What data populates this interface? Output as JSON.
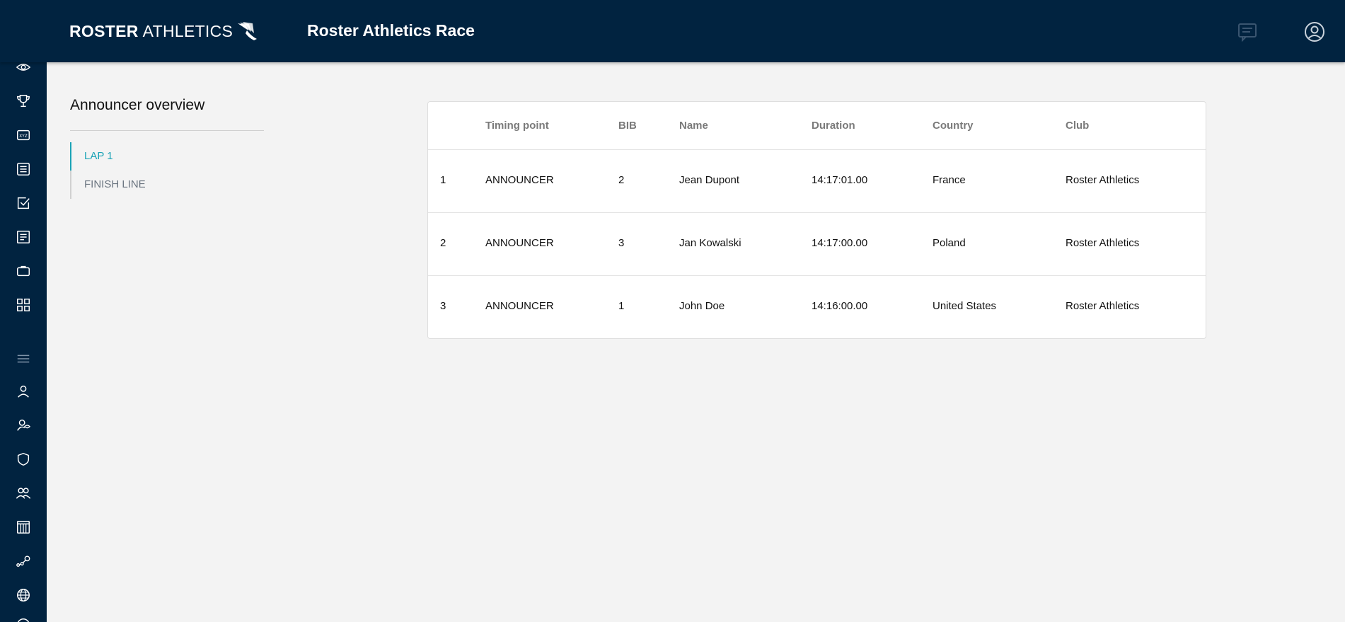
{
  "header": {
    "logo_bold": "ROSTER",
    "logo_light": "ATHLETICS",
    "title": "Roster Athletics Race",
    "chat_icon": "chat-icon",
    "account_icon": "account-circle-icon"
  },
  "sidebar": {
    "items": [
      {
        "icon": "eye-icon"
      },
      {
        "icon": "trophy-icon"
      },
      {
        "icon": "xyz-badge-icon"
      },
      {
        "icon": "list-icon"
      },
      {
        "icon": "checkbox-icon"
      },
      {
        "icon": "document-icon"
      },
      {
        "icon": "briefcase-icon"
      },
      {
        "icon": "grid-icon"
      },
      {
        "icon": "menu-icon"
      },
      {
        "icon": "person-icon"
      },
      {
        "icon": "person-view-icon"
      },
      {
        "icon": "shield-icon"
      },
      {
        "icon": "people-icon"
      },
      {
        "icon": "calendar-icon"
      },
      {
        "icon": "connections-icon"
      },
      {
        "icon": "globe-icon"
      }
    ]
  },
  "overview": {
    "title": "Announcer overview",
    "laps": [
      {
        "label": "LAP 1",
        "active": true
      },
      {
        "label": "FINISH LINE",
        "active": false
      }
    ]
  },
  "table": {
    "columns": [
      "",
      "Timing point",
      "BIB",
      "Name",
      "Duration",
      "Country",
      "Club"
    ],
    "rows": [
      {
        "rank": "1",
        "timing_point": "ANNOUNCER",
        "bib": "2",
        "name": "Jean Dupont",
        "duration": "14:17:01.00",
        "country": "France",
        "club": "Roster Athletics"
      },
      {
        "rank": "2",
        "timing_point": "ANNOUNCER",
        "bib": "3",
        "name": "Jan Kowalski",
        "duration": "14:17:00.00",
        "country": "Poland",
        "club": "Roster Athletics"
      },
      {
        "rank": "3",
        "timing_point": "ANNOUNCER",
        "bib": "1",
        "name": "John Doe",
        "duration": "14:16:00.00",
        "country": "United States",
        "club": "Roster Athletics"
      }
    ]
  },
  "colors": {
    "navy": "#012340",
    "accent": "#1aa3b6",
    "background": "#f3f3f3"
  }
}
